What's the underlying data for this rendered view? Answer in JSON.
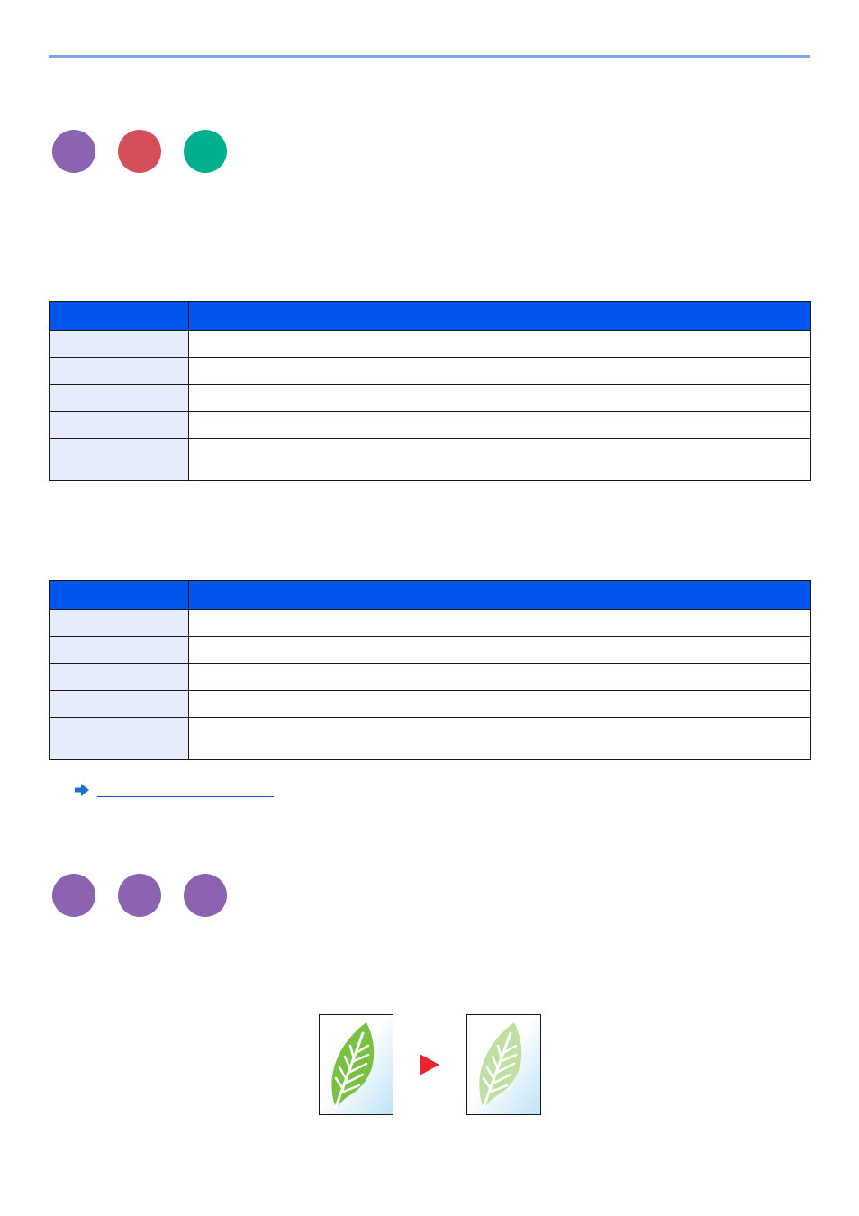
{
  "colors": {
    "rule": "#7fa6ea",
    "table_header": "#0055ee",
    "key_cell": "#e6ecfb",
    "badge_purple": "#8b63b0",
    "badge_red": "#d44f59",
    "badge_green": "#00b08d",
    "arrow_red": "#e8242e",
    "leaf_green": "#7ac143",
    "leaf_light": "#bfe0a2"
  },
  "section1": {
    "badges": [
      {
        "label": "",
        "color": "#8b63b0"
      },
      {
        "label": "",
        "color": "#d44f59"
      },
      {
        "label": "",
        "color": "#00b08d"
      }
    ]
  },
  "table1": {
    "header": [
      "",
      ""
    ],
    "rows": [
      [
        "",
        ""
      ],
      [
        "",
        ""
      ],
      [
        "",
        ""
      ],
      [
        "",
        ""
      ],
      [
        "",
        ""
      ]
    ]
  },
  "table2": {
    "header": [
      "",
      ""
    ],
    "rows": [
      [
        "",
        ""
      ],
      [
        "",
        ""
      ],
      [
        "",
        ""
      ],
      [
        "",
        ""
      ],
      [
        "",
        ""
      ]
    ]
  },
  "reference_link": {
    "icon": "right-arrow-icon",
    "text": ""
  },
  "section2": {
    "badges": [
      {
        "label": "",
        "color": "#8b63b0"
      },
      {
        "label": "",
        "color": "#8b63b0"
      },
      {
        "label": "",
        "color": "#8b63b0"
      }
    ]
  },
  "illustration": {
    "before_icon": "leaf-icon",
    "transition_icon": "play-arrow-icon",
    "after_icon": "leaf-faded-icon"
  }
}
